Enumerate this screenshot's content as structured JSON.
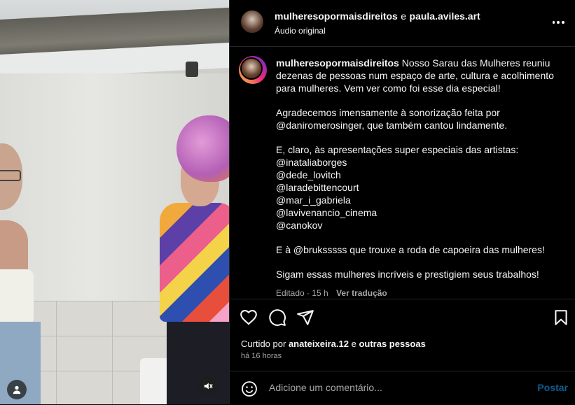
{
  "header": {
    "user1": "mulheresopormaisdireitos",
    "conjunction": "e",
    "user2": "paula.aviles.art",
    "audio": "Áudio original"
  },
  "caption": {
    "username": "mulheresopormaisdireitos",
    "p1": "Nosso Sarau das Mulheres reuniu dezenas de pessoas num espaço de arte, cultura e acolhimento para mulheres. Vem ver como foi esse dia especial!",
    "p2": "Agradecemos imensamente à sonorização feita por @daniromerosinger, que também cantou lindamente.",
    "p3": "E, claro, às apresentações super especiais das artistas:",
    "mentions": [
      "@inataliaborges",
      "@dede_lovitch",
      "@laradebittencourt",
      "@mar_i_gabriela",
      "@lavivenancio_cinema",
      "@canokov"
    ],
    "p4": "E à @bruksssss que trouxe a roda de capoeira das mulheres!",
    "p5": "Sigam essas mulheres incríveis e prestigiem seus trabalhos!",
    "edited": "Editado · 15 h",
    "translate": "Ver tradução"
  },
  "likes": {
    "prefix": "Curtido por",
    "user": "anateixeira.12",
    "conj": "e",
    "others": "outras pessoas"
  },
  "time_ago": "há 16 horas",
  "comment": {
    "placeholder": "Adicione um comentário...",
    "post": "Postar"
  },
  "icons": [
    "user-icon",
    "mute-icon",
    "more-options-icon",
    "heart-icon",
    "comment-icon",
    "share-icon",
    "bookmark-icon",
    "emoji-icon"
  ],
  "colors": {
    "background": "#000000",
    "text": "#f5f5f5",
    "muted": "#a8a8a8",
    "post_button": "#0f5d8f",
    "divider": "#262626"
  }
}
